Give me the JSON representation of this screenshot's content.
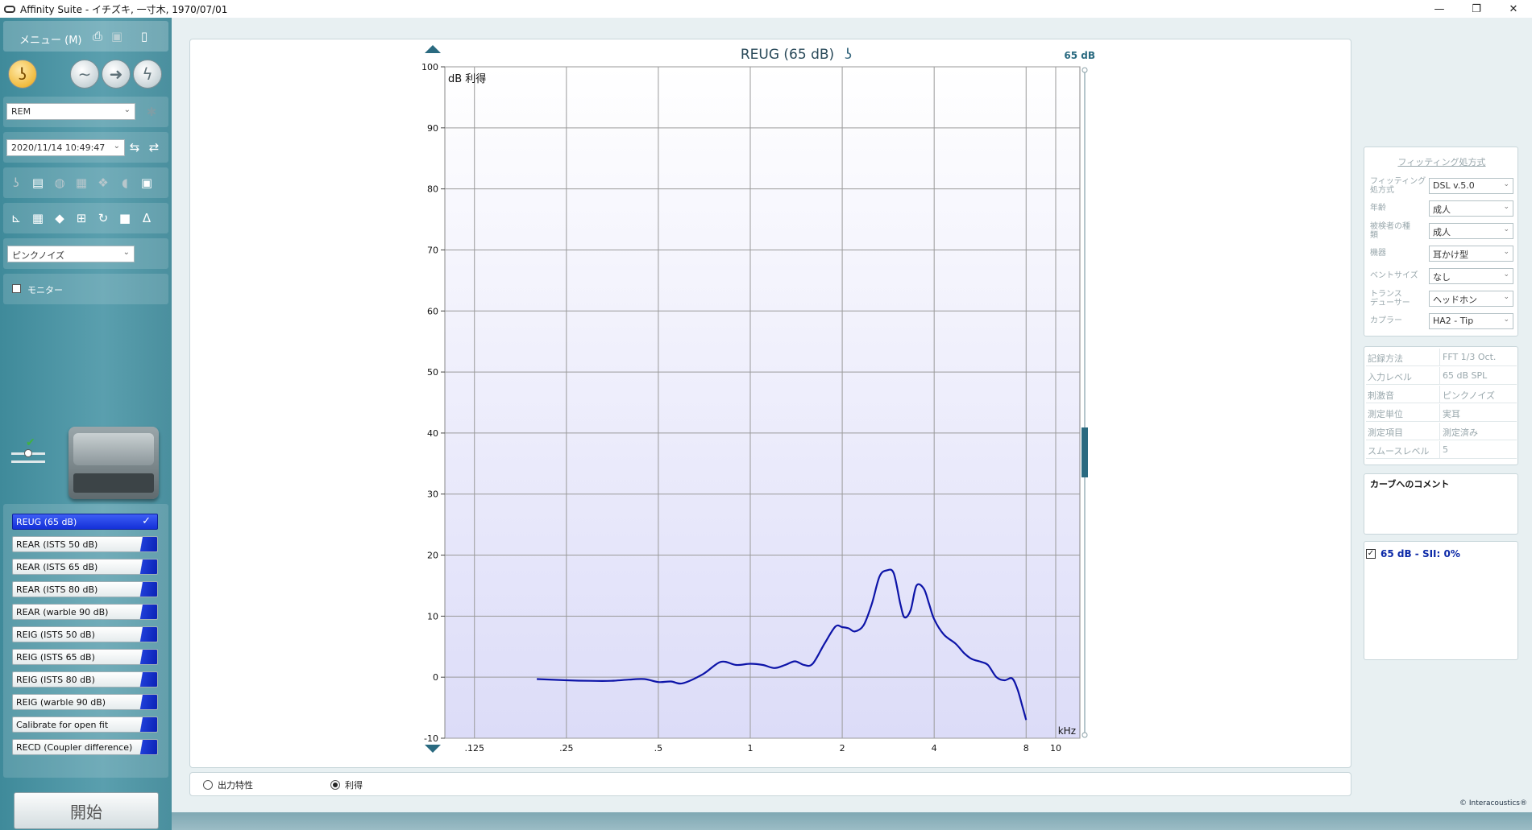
{
  "window": {
    "title": "Affinity Suite - イチズキ, 一寸木, 1970/07/01",
    "minimize": "—",
    "restore": "❐",
    "close": "✕"
  },
  "sidebar": {
    "menu_label": "メニュー (M)",
    "mode_select": "REM",
    "datetime_select": "2020/11/14 10:49:47",
    "stimulus_select": "ピンクノイズ",
    "monitor_label": "モニター",
    "measurements": [
      {
        "label": "REUG (65 dB)",
        "active": true
      },
      {
        "label": "REAR (ISTS 50 dB)",
        "active": false
      },
      {
        "label": "REAR (ISTS 65 dB)",
        "active": false
      },
      {
        "label": "REAR (ISTS 80 dB)",
        "active": false
      },
      {
        "label": "REAR (warble 90 dB)",
        "active": false
      },
      {
        "label": "REIG (ISTS 50 dB)",
        "active": false
      },
      {
        "label": "REIG (ISTS 65 dB)",
        "active": false
      },
      {
        "label": "REIG (ISTS 80 dB)",
        "active": false
      },
      {
        "label": "REIG  (warble 90 dB)",
        "active": false
      },
      {
        "label": "Calibrate for open fit",
        "active": false
      },
      {
        "label": "RECD (Coupler difference)",
        "active": false
      }
    ],
    "start_button": "開始"
  },
  "bottom_bar": {
    "radio_output": "出力特性",
    "radio_gain": "利得",
    "selected": "gain"
  },
  "right_panel": {
    "fitting_title": "フィッティング処方式",
    "fitting_rows": [
      {
        "label": "フィッティング\n処方式",
        "value": "DSL v.5.0"
      },
      {
        "label": "年齢",
        "value": "成人"
      },
      {
        "label": "被検者の種\n類",
        "value": "成人"
      },
      {
        "label": "機器",
        "value": "耳かけ型"
      },
      {
        "label": "ベントサイズ",
        "value": "なし"
      },
      {
        "label": "トランス\nデューサー",
        "value": "ヘッドホン"
      },
      {
        "label": "カプラー",
        "value": "HA2 - Tip"
      }
    ],
    "info_rows": [
      {
        "key": "記録方法",
        "value": "FFT 1/3 Oct."
      },
      {
        "key": "入力レベル",
        "value": "65 dB SPL"
      },
      {
        "key": "刺激音",
        "value": "ピンクノイズ"
      },
      {
        "key": "測定単位",
        "value": "実耳"
      },
      {
        "key": "測定項目",
        "value": "測定済み"
      },
      {
        "key": "スムースレベル",
        "value": "5"
      }
    ],
    "comment_title": "カーブへのコメント",
    "sii_label": "65 dB - SII: 0%"
  },
  "copyright": "© Interacoustics®",
  "chart_data": {
    "type": "line",
    "title": "REUG (65 dB)",
    "level_label": "65 dB",
    "ylabel": "dB 利得",
    "xlabel": "kHz",
    "ylim": [
      -10,
      100
    ],
    "yticks": [
      100,
      90,
      80,
      70,
      60,
      50,
      40,
      30,
      20,
      10,
      0,
      -10
    ],
    "xscale": "log",
    "xlim": [
      0.1,
      12
    ],
    "xticks": [
      {
        "v": 0.125,
        "label": ".125"
      },
      {
        "v": 0.25,
        "label": ".25"
      },
      {
        "v": 0.5,
        "label": ".5"
      },
      {
        "v": 1,
        "label": "1"
      },
      {
        "v": 2,
        "label": "2"
      },
      {
        "v": 4,
        "label": "4"
      },
      {
        "v": 8,
        "label": "8"
      },
      {
        "v": 10,
        "label": "10"
      }
    ],
    "grid": true,
    "series": [
      {
        "color": "#0d14a8",
        "x": [
          0.2,
          0.25,
          0.3,
          0.35,
          0.4,
          0.45,
          0.5,
          0.55,
          0.6,
          0.7,
          0.8,
          0.9,
          1.0,
          1.1,
          1.2,
          1.3,
          1.4,
          1.5,
          1.6,
          1.75,
          1.9,
          2.0,
          2.1,
          2.2,
          2.35,
          2.5,
          2.65,
          2.8,
          2.95,
          3.1,
          3.2,
          3.35,
          3.5,
          3.7,
          3.85,
          4.0,
          4.3,
          4.7,
          5.0,
          5.3,
          5.7,
          6.0,
          6.4,
          6.8,
          7.2,
          7.5,
          7.8,
          8.0
        ],
        "y": [
          -0.3,
          -0.5,
          -0.6,
          -0.6,
          -0.4,
          -0.3,
          -0.8,
          -0.7,
          -1.0,
          0.5,
          2.5,
          2.0,
          2.2,
          2.0,
          1.5,
          2.0,
          2.6,
          2.0,
          2.2,
          5.5,
          8.3,
          8.2,
          8.0,
          7.5,
          8.5,
          12.0,
          16.5,
          17.5,
          17.0,
          12.0,
          9.8,
          11.0,
          15.0,
          14.5,
          12.0,
          9.5,
          7.0,
          5.5,
          4.0,
          3.0,
          2.5,
          2.0,
          0.0,
          -0.5,
          -0.2,
          -2.0,
          -5.0,
          -7.0
        ]
      }
    ]
  }
}
